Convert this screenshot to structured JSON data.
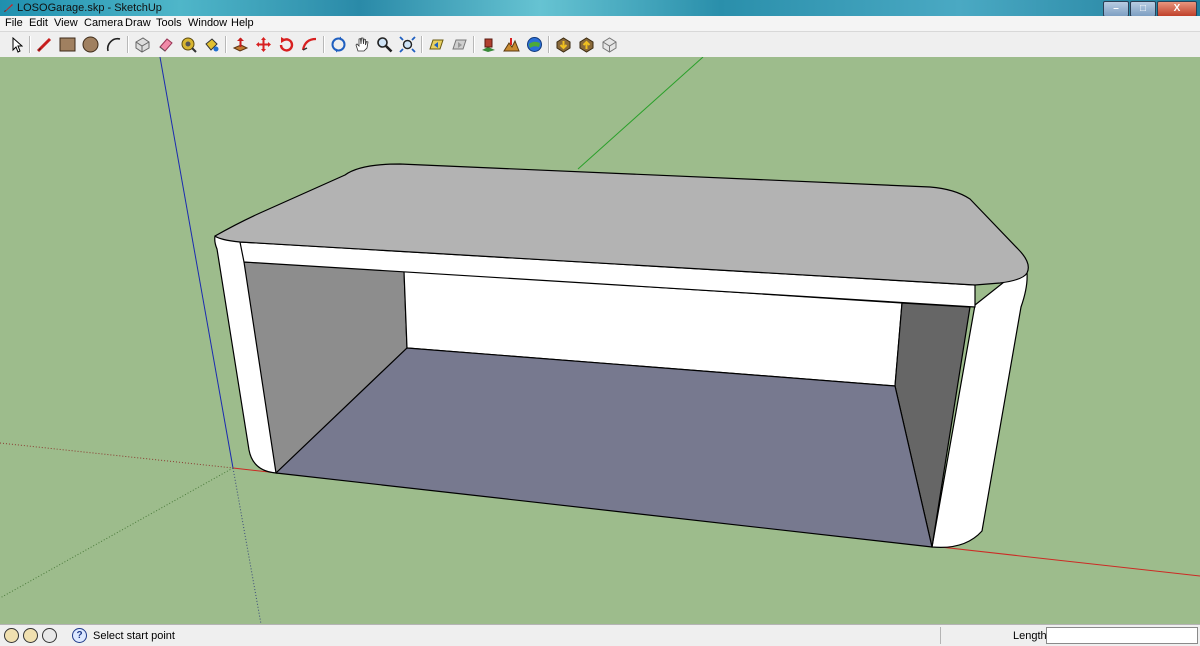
{
  "window": {
    "title": "LOSOGarage.skp - SketchUp",
    "controls": {
      "minimize": "–",
      "maximize": "□",
      "close": "X"
    }
  },
  "menu": {
    "items": [
      "File",
      "Edit",
      "View",
      "Camera",
      "Draw",
      "Tools",
      "Window",
      "Help"
    ]
  },
  "toolbar": {
    "tools": [
      "select-icon",
      "line-icon",
      "rectangle-icon",
      "circle-icon",
      "arc-icon",
      "make-component-icon",
      "eraser-icon",
      "tape-measure-icon",
      "paint-bucket-icon",
      "push-pull-icon",
      "move-icon",
      "rotate-icon",
      "follow-me-icon",
      "orbit-icon",
      "pan-icon",
      "zoom-icon",
      "zoom-extents-icon",
      "previous-view-icon",
      "next-view-icon",
      "add-location-icon",
      "toggle-terrain-icon",
      "google-earth-icon",
      "get-models-icon",
      "share-model-icon",
      "share-component-icon"
    ]
  },
  "viewport": {
    "colors": {
      "background": "#9dbc8c",
      "red_axis": "#cc2a24",
      "green_axis": "#2aa02a",
      "blue_axis": "#1a2ab0",
      "roof": "#b3b3b3",
      "floor": "#77798f",
      "wall_white": "#ffffff",
      "inner_left_wall": "#8d8d8d",
      "inner_right_wall": "#666666"
    },
    "model": "rounded-box garage open at front"
  },
  "status": {
    "icons": [
      "geo-location-icon",
      "credits-icon",
      "copyright-icon",
      "help-icon"
    ],
    "text": "Select start point",
    "length_label": "Length",
    "length_value": ""
  }
}
